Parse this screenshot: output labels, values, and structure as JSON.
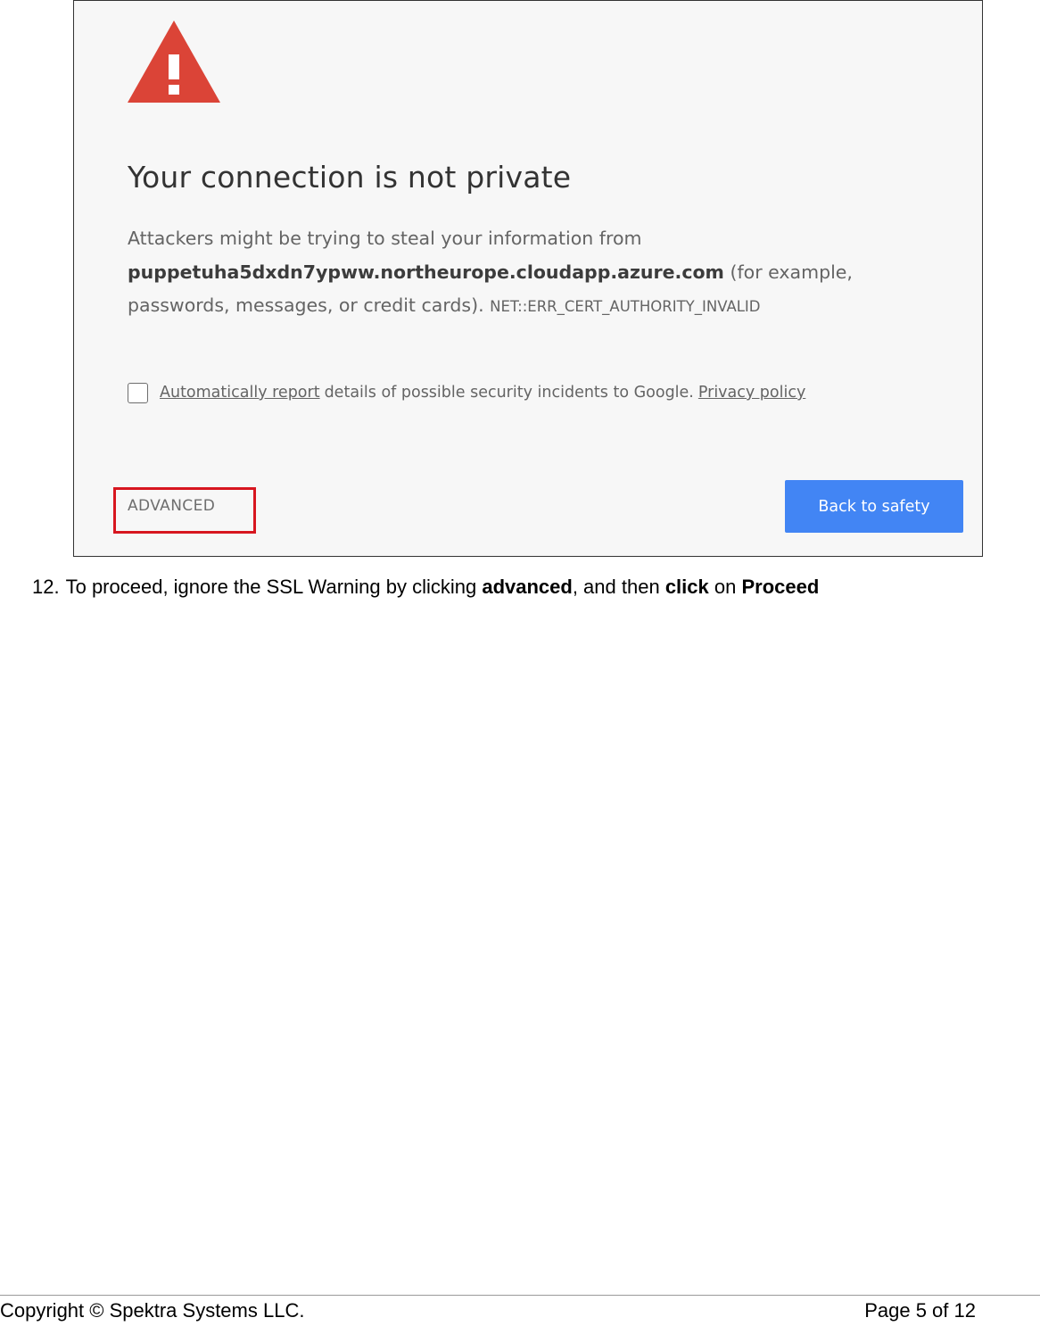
{
  "interstitial": {
    "heading": "Your connection is not private",
    "message_line1": "Attackers might be trying to steal your information from",
    "host": "puppetuha5dxdn7ypww.northeurope.cloudapp.azure.com",
    "message_after_host": " (for example, passwords, messages, or credit cards). ",
    "error_code": "NET::ERR_CERT_AUTHORITY_INVALID",
    "report_link": "Automatically report",
    "report_text": "details of possible security incidents to Google.",
    "privacy_link": "Privacy policy",
    "advanced_label": "ADVANCED",
    "back_label": "Back to safety",
    "colors": {
      "warning_red": "#db4437",
      "highlight_red": "#d7161f",
      "primary_blue": "#4285f4"
    },
    "icon": "warning-triangle-icon"
  },
  "instruction": {
    "number": "12.",
    "text_before": "To proceed, ignore the SSL Warning by clicking ",
    "bold1": "advanced",
    "text_mid": ", and then ",
    "bold2": "click",
    "text_mid2": " on ",
    "bold3": "Proceed"
  },
  "footer": {
    "copyright": "Copyright © Spektra Systems LLC.",
    "page": "Page 5 of 12"
  }
}
